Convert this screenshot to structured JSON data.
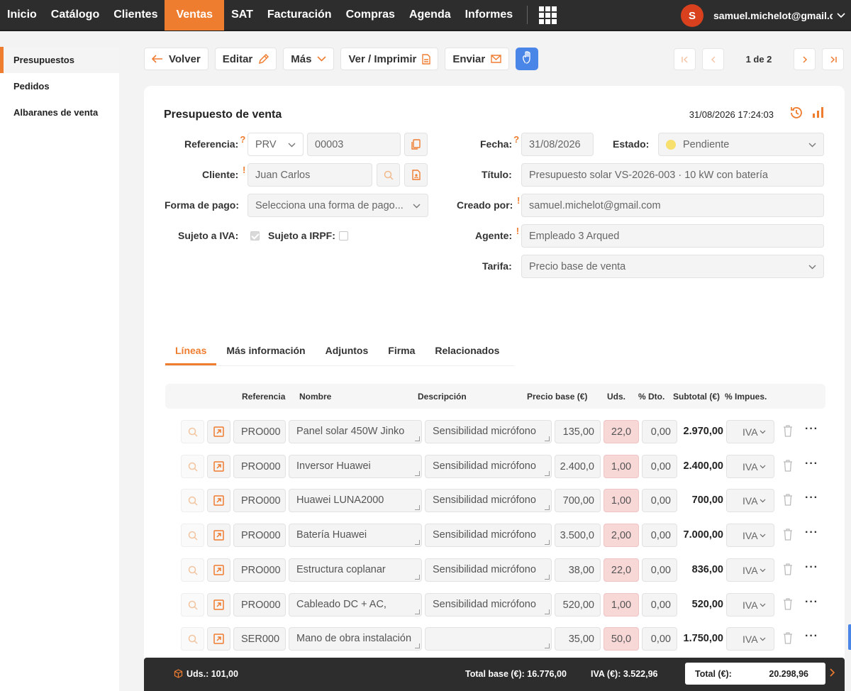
{
  "nav": {
    "items": [
      "Inicio",
      "Catálogo",
      "Clientes",
      "Ventas",
      "SAT",
      "Facturación",
      "Compras",
      "Agenda",
      "Informes"
    ],
    "active": "Ventas",
    "user_initial": "S",
    "user_email": "samuel.michelot@gmail.com"
  },
  "sidebar": {
    "items": [
      "Presupuestos",
      "Pedidos",
      "Albaranes de venta"
    ]
  },
  "toolbar": {
    "back": "Volver",
    "edit": "Editar",
    "more": "Más",
    "print": "Ver / Imprimir",
    "send": "Enviar"
  },
  "pager": {
    "text": "1 de 2"
  },
  "document": {
    "title": "Presupuesto de venta",
    "datetime": "31/08/2026 17:24:03"
  },
  "form": {
    "reference_label": "Referencia:",
    "reference_series": "PRV",
    "reference_number": "00003",
    "client_label": "Cliente:",
    "client_value": "Juan Carlos",
    "payment_label": "Forma de pago:",
    "payment_placeholder": "Selecciona una forma de pago...",
    "iva_label": "Sujeto a IVA:",
    "irpf_label": "Sujeto a IRPF:",
    "iva_checked": true,
    "irpf_checked": false,
    "date_label": "Fecha:",
    "date_value": "31/08/2026",
    "status_label": "Estado:",
    "status_value": "Pendiente",
    "status_color": "#f7e06e",
    "title_label": "Título:",
    "title_value": "Presupuesto solar VS-2026-003 · 10 kW con batería",
    "created_label": "Creado por:",
    "created_value": "samuel.michelot@gmail.com",
    "agent_label": "Agente:",
    "agent_value": "Empleado 3 Arqued",
    "tariff_label": "Tarifa:",
    "tariff_value": "Precio base de venta"
  },
  "tabs": [
    "Líneas",
    "Más información",
    "Adjuntos",
    "Firma",
    "Relacionados"
  ],
  "table": {
    "headers": [
      "Referencia",
      "Nombre",
      "Descripción",
      "Precio base (€)",
      "Uds.",
      "% Dto.",
      "Subtotal (€)",
      "% Impues."
    ],
    "rows": [
      {
        "ref": "PRO000",
        "name": "Panel solar 450W Jinko",
        "desc": "Sensibilidad micrófono",
        "price": "135,00",
        "qty": "22,0",
        "dto": "0,00",
        "subtotal": "2.970,00",
        "tax": "IVA"
      },
      {
        "ref": "PRO000",
        "name": "Inversor Huawei",
        "desc": "Sensibilidad micrófono",
        "price": "2.400,0",
        "qty": "1,00",
        "dto": "0,00",
        "subtotal": "2.400,00",
        "tax": "IVA"
      },
      {
        "ref": "PRO000",
        "name": "Huawei LUNA2000",
        "desc": "Sensibilidad micrófono",
        "price": "700,00",
        "qty": "1,00",
        "dto": "0,00",
        "subtotal": "700,00",
        "tax": "IVA"
      },
      {
        "ref": "PRO000",
        "name": "Batería Huawei",
        "desc": "Sensibilidad micrófono",
        "price": "3.500,0",
        "qty": "2,00",
        "dto": "0,00",
        "subtotal": "7.000,00",
        "tax": "IVA"
      },
      {
        "ref": "PRO000",
        "name": "Estructura coplanar",
        "desc": "Sensibilidad micrófono",
        "price": "38,00",
        "qty": "22,0",
        "dto": "0,00",
        "subtotal": "836,00",
        "tax": "IVA"
      },
      {
        "ref": "PRO000",
        "name": "Cableado DC + AC,",
        "desc": "Sensibilidad micrófono",
        "price": "520,00",
        "qty": "1,00",
        "dto": "0,00",
        "subtotal": "520,00",
        "tax": "IVA"
      },
      {
        "ref": "SER000",
        "name": "Mano de obra instalación",
        "desc": "",
        "price": "35,00",
        "qty": "50,0",
        "dto": "0,00",
        "subtotal": "1.750,00",
        "tax": "IVA"
      }
    ]
  },
  "footer": {
    "units": "Uds.: 101,00",
    "total_base": "Total base (€): 16.776,00",
    "iva": "IVA (€): 3.522,96",
    "total_label": "Total (€):",
    "total_value": "20.298,96"
  },
  "colors": {
    "accent": "#ef7d30",
    "nav_bg": "#2d2d2d",
    "blue": "#4a86e8"
  }
}
